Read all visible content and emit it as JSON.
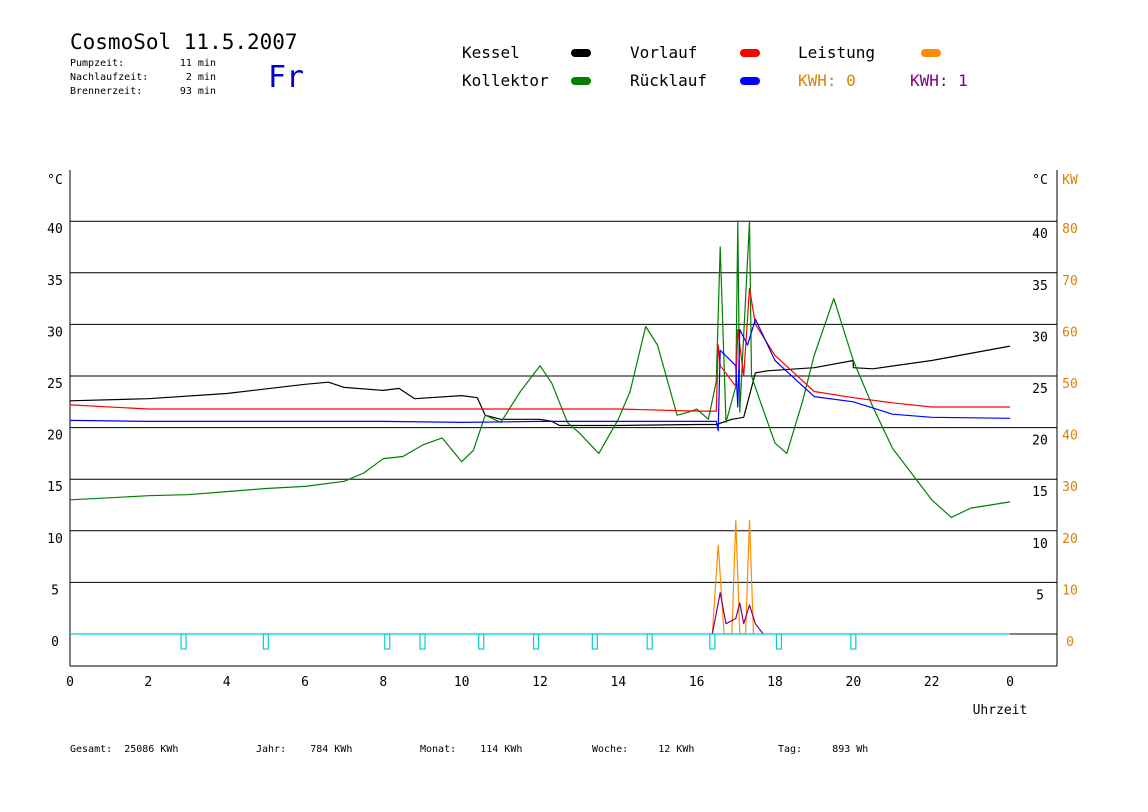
{
  "header": {
    "title": "CosmoSol 11.5.2007",
    "day": "Fr",
    "info": [
      {
        "label": "Pumpzeit:",
        "value": "11 min"
      },
      {
        "label": "Nachlaufzeit:",
        "value": "2 min"
      },
      {
        "label": "Brennerzeit:",
        "value": "93 min"
      }
    ]
  },
  "legend": {
    "kessel": {
      "label": "Kessel",
      "color": "#000000"
    },
    "kollektor": {
      "label": "Kollektor",
      "color": "#008000"
    },
    "vorlauf": {
      "label": "Vorlauf",
      "color": "#ff0000"
    },
    "ruecklauf": {
      "label": "Rücklauf",
      "color": "#0000ff"
    },
    "leistung": {
      "label": "Leistung",
      "color": "#ff8c00"
    },
    "kwh0": {
      "label": "KWH: 0",
      "color": "#ff8c00"
    },
    "kwh1": {
      "label": "KWH: 1",
      "color": "#800080"
    }
  },
  "footer": [
    {
      "label": "Gesamt:",
      "value": "25086 KWh"
    },
    {
      "label": "Jahr:",
      "value": "784 KWh"
    },
    {
      "label": "Monat:",
      "value": "114 KWh"
    },
    {
      "label": "Woche:",
      "value": "12 KWh"
    },
    {
      "label": "Tag:",
      "value": "893 Wh"
    }
  ],
  "chart_data": {
    "type": "line",
    "xlabel": "Uhrzeit",
    "ylabel_left": "°C",
    "ylabel_right_temp": "°C",
    "ylabel_right_power": "KW",
    "xlim": [
      0,
      24
    ],
    "ylim": [
      -3,
      45
    ],
    "x_ticks": [
      "0",
      "2",
      "4",
      "6",
      "8",
      "10",
      "12",
      "14",
      "16",
      "18",
      "20",
      "22",
      "0"
    ],
    "y_ticks_left": [
      "0",
      "5",
      "10",
      "15",
      "20",
      "25",
      "30",
      "35",
      "40",
      "°C"
    ],
    "y_ticks_right_temp": [
      "5",
      "10",
      "15",
      "20",
      "25",
      "30",
      "35",
      "40",
      "°C"
    ],
    "y_ticks_right_power": [
      "0",
      "10",
      "20",
      "30",
      "40",
      "50",
      "60",
      "70",
      "80",
      "KW"
    ],
    "series": [
      {
        "name": "Kessel",
        "color": "#000000",
        "points": [
          [
            0,
            22.6
          ],
          [
            2,
            22.8
          ],
          [
            4,
            23.3
          ],
          [
            6,
            24.2
          ],
          [
            6.6,
            24.4
          ],
          [
            7,
            23.9
          ],
          [
            8,
            23.6
          ],
          [
            8.4,
            23.8
          ],
          [
            8.8,
            22.8
          ],
          [
            10,
            23.1
          ],
          [
            10.4,
            22.9
          ],
          [
            10.6,
            21.2
          ],
          [
            11,
            20.8
          ],
          [
            12,
            20.8
          ],
          [
            12.3,
            20.6
          ],
          [
            12.5,
            20.2
          ],
          [
            14,
            20.2
          ],
          [
            16,
            20.3
          ],
          [
            16.5,
            20.3
          ],
          [
            16.9,
            20.8
          ],
          [
            17.2,
            21.0
          ],
          [
            17.5,
            25.3
          ],
          [
            17.8,
            25.5
          ],
          [
            19,
            25.8
          ],
          [
            20,
            26.5
          ],
          [
            20,
            25.8
          ],
          [
            20.5,
            25.7
          ],
          [
            22,
            26.5
          ],
          [
            24,
            27.9
          ]
        ]
      },
      {
        "name": "Kollektor",
        "color": "#008000",
        "points": [
          [
            0,
            13.0
          ],
          [
            1,
            13.2
          ],
          [
            2,
            13.4
          ],
          [
            3,
            13.5
          ],
          [
            4,
            13.8
          ],
          [
            5,
            14.1
          ],
          [
            6,
            14.3
          ],
          [
            7,
            14.8
          ],
          [
            7.5,
            15.6
          ],
          [
            8,
            17.0
          ],
          [
            8.5,
            17.2
          ],
          [
            9,
            18.3
          ],
          [
            9.5,
            19.0
          ],
          [
            10,
            16.7
          ],
          [
            10.3,
            17.8
          ],
          [
            10.6,
            21.2
          ],
          [
            11,
            20.5
          ],
          [
            11.5,
            23.5
          ],
          [
            12,
            26.0
          ],
          [
            12.3,
            24.3
          ],
          [
            12.7,
            20.5
          ],
          [
            13,
            19.5
          ],
          [
            13.5,
            17.5
          ],
          [
            14,
            20.8
          ],
          [
            14.3,
            23.5
          ],
          [
            14.7,
            29.8
          ],
          [
            15,
            28.0
          ],
          [
            15.5,
            21.2
          ],
          [
            15.8,
            21.5
          ],
          [
            16,
            21.8
          ],
          [
            16.3,
            20.8
          ],
          [
            16.5,
            24.5
          ],
          [
            16.6,
            37.5
          ],
          [
            16.75,
            20.5
          ],
          [
            17.0,
            24.0
          ],
          [
            17.05,
            40.0
          ],
          [
            17.1,
            21.5
          ],
          [
            17.35,
            40.0
          ],
          [
            17.4,
            25.0
          ],
          [
            17.6,
            22.8
          ],
          [
            18,
            18.5
          ],
          [
            18.3,
            17.5
          ],
          [
            18.7,
            22.5
          ],
          [
            19,
            27.0
          ],
          [
            19.5,
            32.5
          ],
          [
            20,
            26.5
          ],
          [
            20.5,
            22.0
          ],
          [
            21,
            18.0
          ],
          [
            22,
            13.0
          ],
          [
            22.5,
            11.3
          ],
          [
            23,
            12.2
          ],
          [
            24,
            12.8
          ]
        ]
      },
      {
        "name": "Vorlauf",
        "color": "#ff0000",
        "points": [
          [
            0,
            22.2
          ],
          [
            2,
            21.8
          ],
          [
            4,
            21.8
          ],
          [
            6,
            21.8
          ],
          [
            8,
            21.8
          ],
          [
            10,
            21.8
          ],
          [
            12,
            21.8
          ],
          [
            14,
            21.8
          ],
          [
            16,
            21.6
          ],
          [
            16.5,
            21.6
          ],
          [
            16.55,
            28.0
          ],
          [
            16.6,
            26.0
          ],
          [
            17.0,
            24.0
          ],
          [
            17.05,
            29.5
          ],
          [
            17.2,
            25.0
          ],
          [
            17.35,
            33.5
          ],
          [
            17.5,
            30.0
          ],
          [
            18,
            27.0
          ],
          [
            19,
            23.5
          ],
          [
            20,
            22.9
          ],
          [
            21,
            22.4
          ],
          [
            22,
            22.0
          ],
          [
            24,
            22.0
          ]
        ]
      },
      {
        "name": "Rücklauf",
        "color": "#0000ff",
        "points": [
          [
            0,
            20.7
          ],
          [
            2,
            20.6
          ],
          [
            4,
            20.6
          ],
          [
            6,
            20.6
          ],
          [
            8,
            20.6
          ],
          [
            10,
            20.5
          ],
          [
            12,
            20.6
          ],
          [
            14,
            20.6
          ],
          [
            16,
            20.6
          ],
          [
            16.5,
            20.6
          ],
          [
            16.55,
            19.7
          ],
          [
            16.6,
            27.5
          ],
          [
            17.0,
            26.0
          ],
          [
            17.05,
            22.0
          ],
          [
            17.1,
            29.5
          ],
          [
            17.3,
            28.0
          ],
          [
            17.5,
            30.5
          ],
          [
            18,
            26.5
          ],
          [
            19,
            23.0
          ],
          [
            20,
            22.5
          ],
          [
            21,
            21.3
          ],
          [
            22,
            21.0
          ],
          [
            24,
            20.9
          ]
        ]
      },
      {
        "name": "Leistung",
        "color": "#ff8c00",
        "points": [
          [
            16.4,
            0
          ],
          [
            16.55,
            8.6
          ],
          [
            16.7,
            0
          ],
          [
            16.9,
            0
          ],
          [
            17.0,
            11.0
          ],
          [
            17.1,
            0
          ],
          [
            17.25,
            0
          ],
          [
            17.35,
            11.0
          ],
          [
            17.45,
            0
          ]
        ]
      },
      {
        "name": "KWH",
        "color": "#800080",
        "points": [
          [
            16.4,
            0
          ],
          [
            16.6,
            4.0
          ],
          [
            16.75,
            1.0
          ],
          [
            17.0,
            1.5
          ],
          [
            17.1,
            3.0
          ],
          [
            17.2,
            1.0
          ],
          [
            17.35,
            2.8
          ],
          [
            17.5,
            1.0
          ],
          [
            17.7,
            0
          ]
        ]
      },
      {
        "name": "Pumpe",
        "color": "#00d0d0",
        "pulses": [
          2.9,
          5.0,
          8.1,
          9.0,
          10.5,
          11.9,
          13.4,
          14.8,
          16.4,
          18.1,
          20.0
        ]
      }
    ]
  }
}
